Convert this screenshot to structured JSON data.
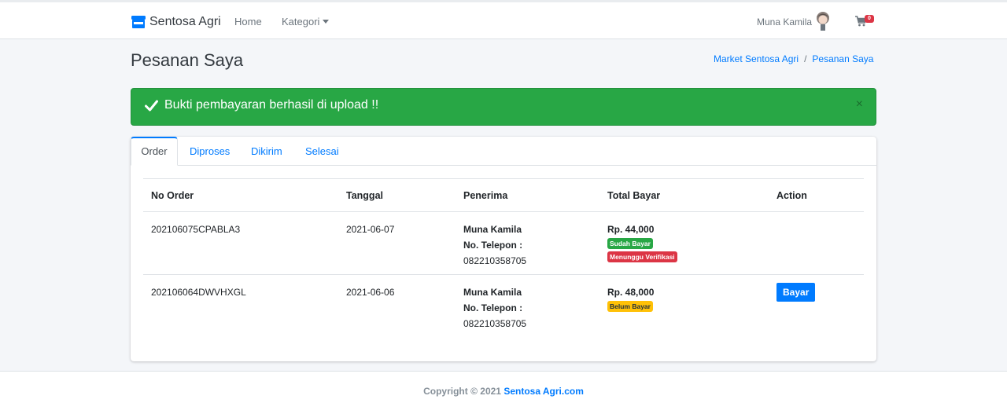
{
  "navbar": {
    "brand": "Sentosa Agri",
    "home_label": "Home",
    "kategori_label": "Kategori",
    "user_name": "Muna Kamila",
    "cart_count": "0"
  },
  "header": {
    "title": "Pesanan Saya",
    "breadcrumb": [
      "Market Sentosa Agri",
      "/",
      "Pesanan Saya"
    ]
  },
  "alert": {
    "message": "Bukti pembayaran berhasil di upload !!",
    "close": "×",
    "color": "#28a745"
  },
  "tabs": [
    "Order",
    "Diproses",
    "Dikirim",
    "Selesai"
  ],
  "table": {
    "headers": [
      "No Order",
      "Tanggal",
      "Penerima",
      "Total Bayar",
      "Action"
    ],
    "rows": [
      {
        "no_order": "202106075CPABLA3",
        "tanggal": "2021-06-07",
        "penerima": "Muna Kamila",
        "telepon_label": "No. Telepon :",
        "telepon": "082210358705",
        "total": "Rp. 44,000",
        "badge1": "Sudah Bayar",
        "badge2": "Menunggu Verifikasi"
      },
      {
        "no_order": "202106064DWVHXGL",
        "tanggal": "2021-06-06",
        "penerima": "Muna Kamila",
        "telepon_label": "No. Telepon :",
        "telepon": "082210358705",
        "total": "Rp. 48,000",
        "badge1": "Belum Bayar",
        "action": "Bayar"
      }
    ]
  },
  "footer": {
    "copyright": "Copyright © 2021",
    "link": "Sentosa Agri.com"
  },
  "colors": {
    "accent": "#007bff",
    "success": "#28a745",
    "danger": "#dc3545",
    "warning": "#ffc107"
  },
  "icons": [
    "store-icon",
    "caret-down-icon",
    "avatar-icon",
    "cart-icon",
    "check-icon",
    "close-icon"
  ]
}
